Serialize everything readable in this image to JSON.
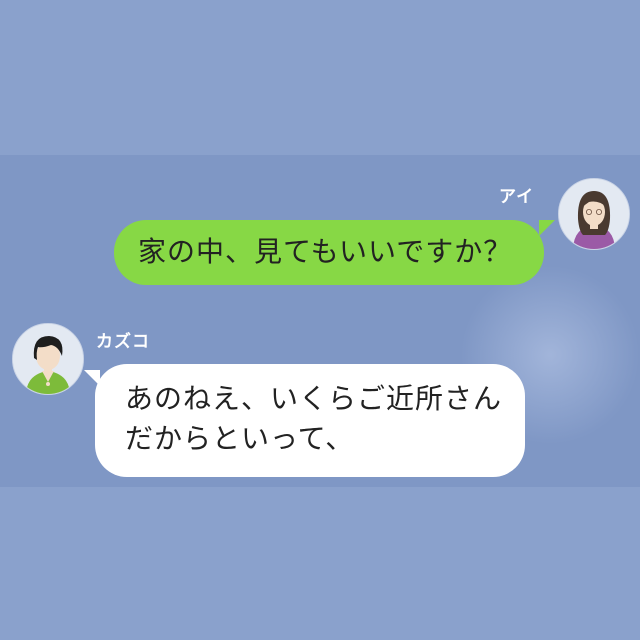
{
  "messages": [
    {
      "sender": "アイ",
      "direction": "outgoing",
      "lines": [
        "家の中、見てもいいですか？"
      ]
    },
    {
      "sender": "カズコ",
      "direction": "incoming",
      "lines": [
        "あのねえ、いくらご近所さん",
        "だからといって、"
      ]
    }
  ],
  "colors": {
    "background": "#8aa1cc",
    "chat_area": "#7f97c5",
    "outgoing_bubble": "#87d845",
    "incoming_bubble": "#ffffff"
  }
}
